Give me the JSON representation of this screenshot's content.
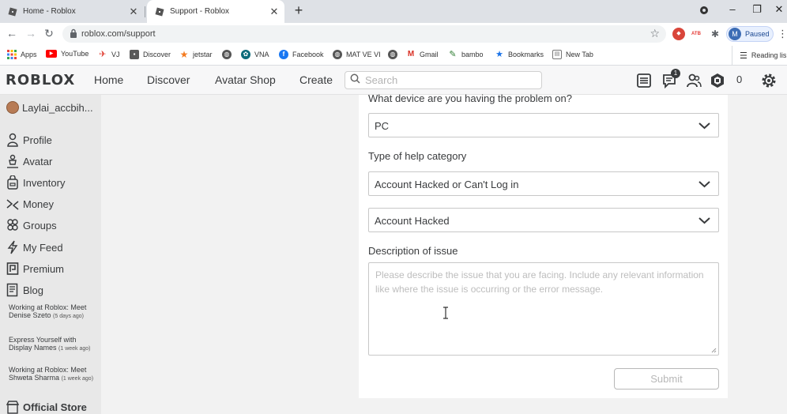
{
  "browser": {
    "tabs": [
      {
        "title": "Home - Roblox",
        "active": false
      },
      {
        "title": "Support - Roblox",
        "active": true
      }
    ],
    "new_tab_label": "+",
    "address": {
      "url": "roblox.com/support"
    },
    "profile": {
      "initial": "M",
      "status": "Paused"
    },
    "bookmarks": [
      {
        "label": "Apps",
        "icon": "apps-grid-icon",
        "color": "#e8453c"
      },
      {
        "label": "YouTube",
        "icon": "youtube-icon",
        "color": "#ff0000"
      },
      {
        "label": "VJ",
        "icon": "plane-icon",
        "color": "#e03b2f"
      },
      {
        "label": "Discover",
        "icon": "roblox-icon",
        "color": "#5a5a5a"
      },
      {
        "label": "jetstar",
        "icon": "jetstar-star-icon",
        "color": "#f47b20"
      },
      {
        "label": "",
        "icon": "globe-icon",
        "color": "#555555"
      },
      {
        "label": "VNA",
        "icon": "vna-icon",
        "color": "#0c6b7a"
      },
      {
        "label": "Facebook",
        "icon": "facebook-icon",
        "color": "#1877f2"
      },
      {
        "label": "MAT VE VI",
        "icon": "globe-icon",
        "color": "#555555"
      },
      {
        "label": "",
        "icon": "globe-icon",
        "color": "#555555"
      },
      {
        "label": "Gmail",
        "icon": "gmail-icon",
        "color": "#d93025"
      },
      {
        "label": "bambo",
        "icon": "bambo-icon",
        "color": "#2e7d32"
      },
      {
        "label": "Bookmarks",
        "icon": "bookmark-star-icon",
        "color": "#1a73e8"
      },
      {
        "label": "New Tab",
        "icon": "newtab-icon",
        "color": "#777777"
      }
    ],
    "reading_list": "Reading lis"
  },
  "header": {
    "logo": "ROBLOX",
    "nav": [
      "Home",
      "Discover",
      "Avatar Shop",
      "Create"
    ],
    "search_placeholder": "Search",
    "notifications_badge": "1",
    "robux_balance": "0"
  },
  "sidebar": {
    "username": "Laylai_accbih...",
    "items": [
      {
        "label": "Profile",
        "icon": "profile-icon"
      },
      {
        "label": "Avatar",
        "icon": "avatar-icon"
      },
      {
        "label": "Inventory",
        "icon": "inventory-icon"
      },
      {
        "label": "Money",
        "icon": "money-icon"
      },
      {
        "label": "Groups",
        "icon": "groups-icon"
      },
      {
        "label": "My Feed",
        "icon": "feed-icon"
      },
      {
        "label": "Premium",
        "icon": "premium-icon"
      },
      {
        "label": "Blog",
        "icon": "blog-icon"
      }
    ],
    "blog_posts": [
      {
        "title": "Working at Roblox: Meet Denise Szeto",
        "ago": "(5 days ago)"
      },
      {
        "title": "Express Yourself with Display Names",
        "ago": "(1 week ago)"
      },
      {
        "title": "Working at Roblox: Meet Shweta Sharma",
        "ago": "(1 week ago)"
      }
    ],
    "official_store": "Official Store"
  },
  "form": {
    "device_label": "What device are you having the problem on?",
    "device_value": "PC",
    "category_label": "Type of help category",
    "category_value": "Account Hacked or Can't Log in",
    "subcategory_value": "Account Hacked",
    "description_label": "Description of issue",
    "description_placeholder": "Please describe the issue that you are facing. Include any relevant information like where the issue is occurring or the error message.",
    "submit_label": "Submit"
  }
}
